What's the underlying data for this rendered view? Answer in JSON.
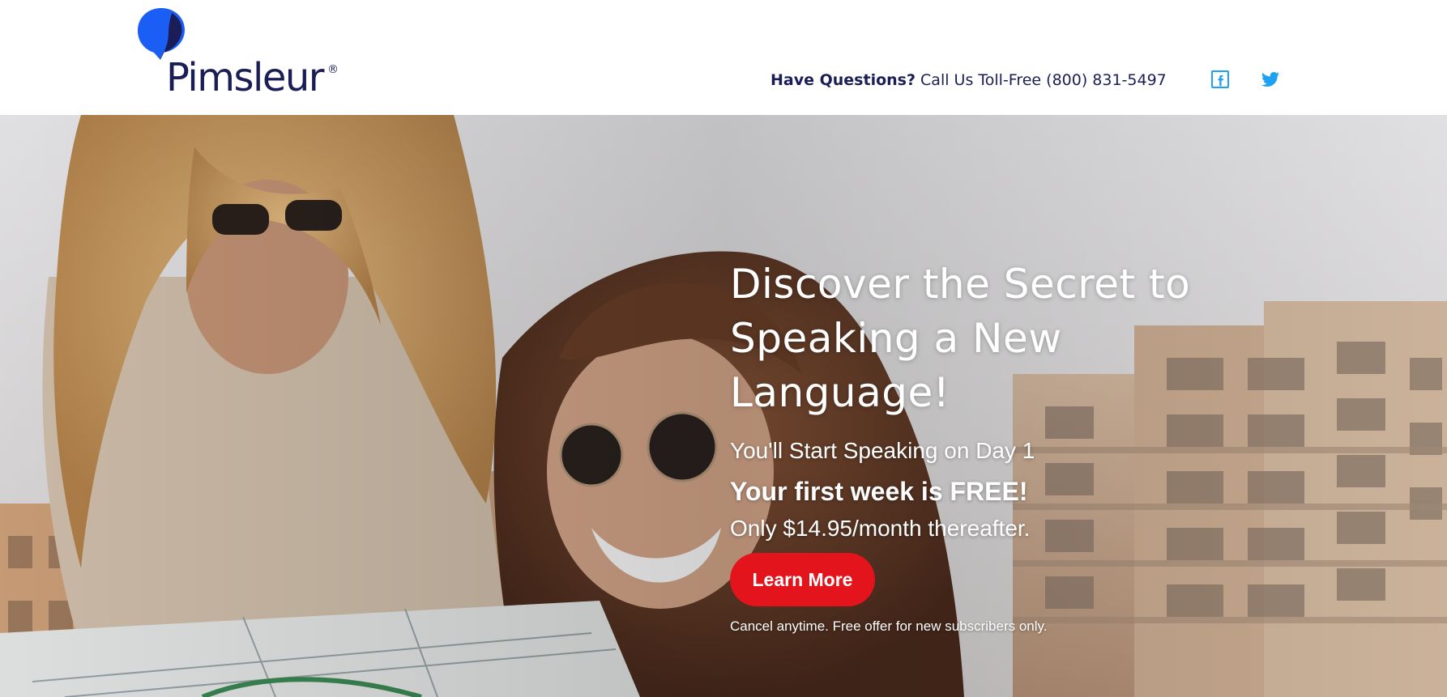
{
  "brand": {
    "name": "Pimsleur",
    "registered_mark": "®",
    "logo_blue": "#1a5ef5",
    "logo_navy": "#1b1e56"
  },
  "header": {
    "contact_question": "Have Questions?",
    "contact_text": " Call Us Toll-Free (800) 831-5497",
    "social_icons": [
      "facebook-icon",
      "twitter-icon"
    ],
    "social_color": "#1da1f2"
  },
  "hero": {
    "headline_line1": "Discover the Secret to",
    "headline_line2": "Speaking a New",
    "headline_line3": "Language!",
    "subline": "You'll Start Speaking on Day 1",
    "offer": "Your first week is FREE!",
    "price": "Only $14.95/month thereafter.",
    "cta_label": "Learn More",
    "cta_color": "#e3141b",
    "fineprint": "Cancel anytime. Free offer for new subscribers only."
  }
}
